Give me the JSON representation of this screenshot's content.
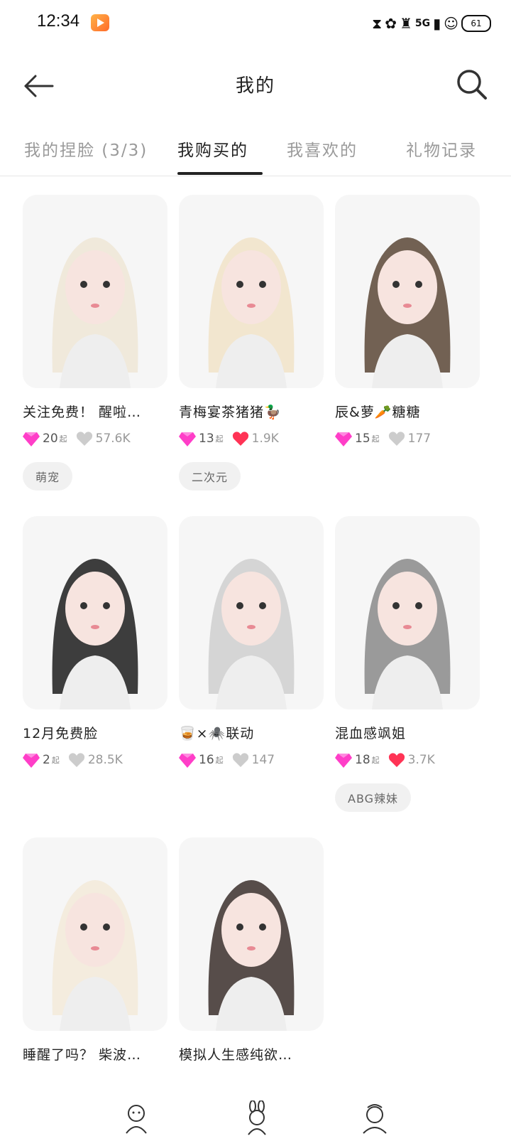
{
  "status": {
    "time": "12:34",
    "network": "5G",
    "battery": "61"
  },
  "header": {
    "title": "我的"
  },
  "tabs": [
    {
      "label": "我的捏脸 (3/3)",
      "active": false
    },
    {
      "label": "我购买的",
      "active": true
    },
    {
      "label": "我喜欢的",
      "active": false
    },
    {
      "label": "礼物记录",
      "active": false
    }
  ],
  "items": [
    {
      "title": "关注免费！ 醒啦…",
      "price": "20",
      "price_unit": "起",
      "likes": "57.6K",
      "liked": false,
      "tag": "萌宠",
      "hair": "#efe6d6"
    },
    {
      "title": "青梅宴茶猪猪🦆",
      "price": "13",
      "price_unit": "起",
      "likes": "1.9K",
      "liked": true,
      "tag": "二次元",
      "hair": "#f1e3c8"
    },
    {
      "title": "辰&萝🥕糖糖",
      "price": "15",
      "price_unit": "起",
      "likes": "177",
      "liked": false,
      "tag": "",
      "hair": "#5a4636"
    },
    {
      "title": "12月免费脸",
      "price": "2",
      "price_unit": "起",
      "likes": "28.5K",
      "liked": false,
      "tag": "",
      "hair": "#1c1c1c"
    },
    {
      "title": "🥃×🕷️联动",
      "price": "16",
      "price_unit": "起",
      "likes": "147",
      "liked": false,
      "tag": "",
      "hair": "#cfcfcf"
    },
    {
      "title": "混血感飒姐",
      "price": "18",
      "price_unit": "起",
      "likes": "3.7K",
      "liked": true,
      "tag": "ABG辣妹",
      "hair": "#8a8a8a"
    },
    {
      "title": "睡醒了吗？ 柴波…",
      "price": "",
      "price_unit": "",
      "likes": "",
      "liked": false,
      "tag": "",
      "hair": "#f3ead9"
    },
    {
      "title": "模拟人生感纯欲…",
      "price": "",
      "price_unit": "",
      "likes": "",
      "liked": false,
      "tag": "",
      "hair": "#3b2f2c"
    }
  ],
  "colors": {
    "gem": "#ff3ec8",
    "heart_liked": "#ff3355",
    "heart_plain": "#cccccc"
  },
  "icons": {
    "back": "arrow-left-icon",
    "search": "search-icon",
    "gem": "diamond-icon",
    "heart": "heart-icon"
  }
}
